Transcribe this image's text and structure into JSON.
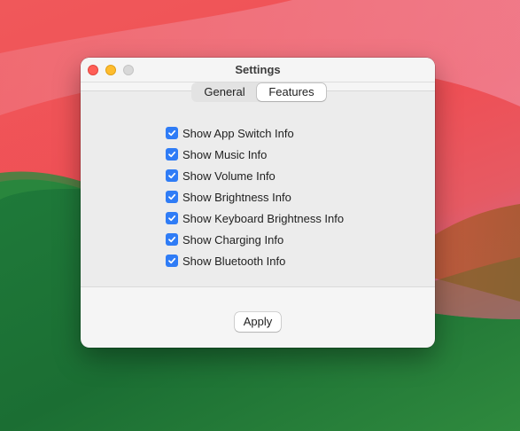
{
  "window": {
    "title": "Settings"
  },
  "tabs": [
    {
      "label": "General",
      "selected": false
    },
    {
      "label": "Features",
      "selected": true
    }
  ],
  "options": [
    {
      "label": "Show App Switch Info",
      "checked": true
    },
    {
      "label": "Show Music Info",
      "checked": true
    },
    {
      "label": "Show Volume Info",
      "checked": true
    },
    {
      "label": "Show Brightness Info",
      "checked": true
    },
    {
      "label": "Show Keyboard Brightness Info",
      "checked": true
    },
    {
      "label": "Show Charging Info",
      "checked": true
    },
    {
      "label": "Show Bluetooth Info",
      "checked": true
    }
  ],
  "apply_label": "Apply",
  "colors": {
    "checkbox": "#2f7cf6",
    "close": "#ff5f57",
    "minimize": "#febc2e",
    "zoom_disabled": "#d8d8d8"
  }
}
